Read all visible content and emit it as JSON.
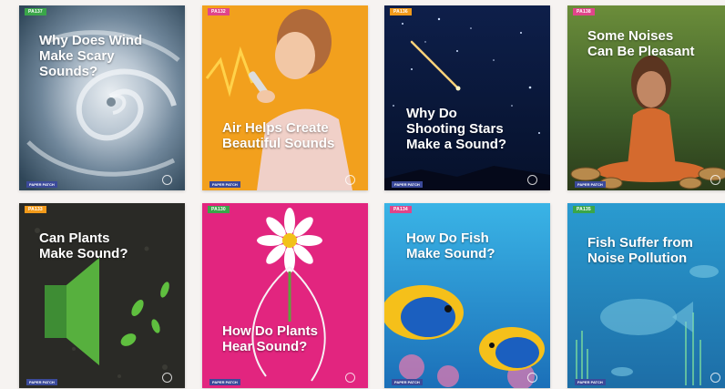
{
  "cards": [
    {
      "tag": "PA137",
      "title": "Why Does Wind\nMake Scary\nSounds?",
      "footer": "PAPER PATCH"
    },
    {
      "tag": "PA132",
      "title": "Air Helps Create\nBeautiful Sounds",
      "footer": "PAPER PATCH"
    },
    {
      "tag": "PA136",
      "title": "Why Do\nShooting Stars\nMake a Sound?",
      "footer": "PAPER PATCH"
    },
    {
      "tag": "PA138",
      "title": "Some Noises\nCan Be Pleasant",
      "footer": "PAPER PATCH"
    },
    {
      "tag": "PA133",
      "title": "Can Plants\nMake Sound?",
      "footer": "PAPER PATCH"
    },
    {
      "tag": "PA130",
      "title": "How Do Plants\nHear Sound?",
      "footer": "PAPER PATCH"
    },
    {
      "tag": "PA134",
      "title": "How Do Fish\nMake Sound?",
      "footer": "PAPER PATCH"
    },
    {
      "tag": "PA135",
      "title": "Fish Suffer from\nNoise Pollution",
      "footer": "PAPER PATCH"
    }
  ],
  "colors": {
    "tag_green": "#3aa64a",
    "tag_orange": "#f29a1a",
    "tag_pink": "#e0458a",
    "footer_blue": "#3b4a9a"
  }
}
